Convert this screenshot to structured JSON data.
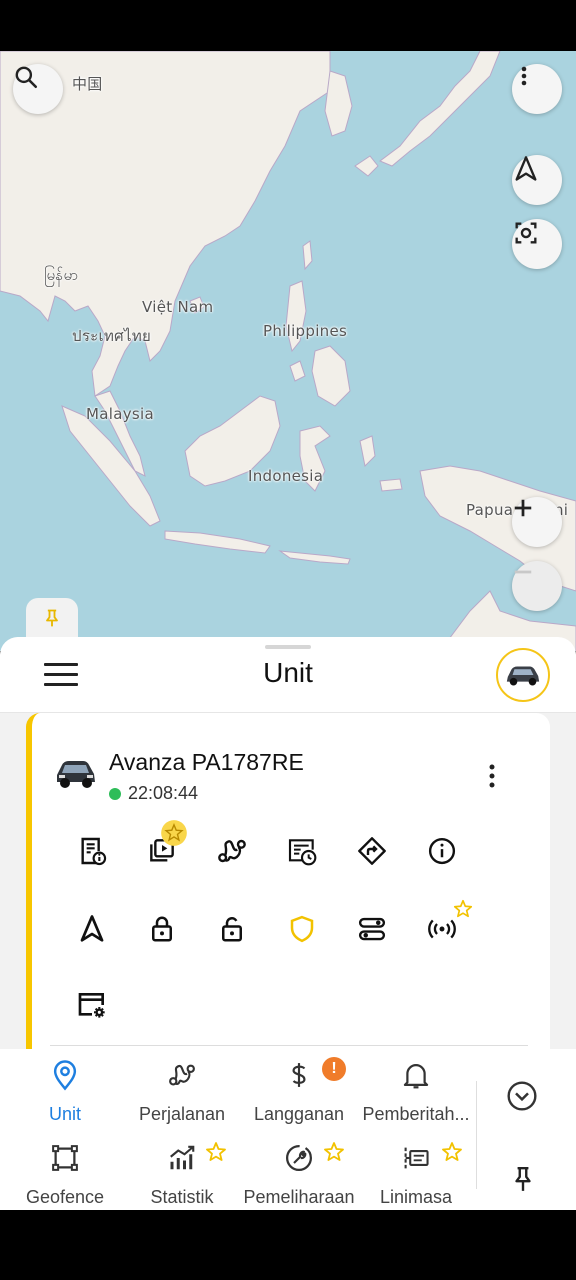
{
  "map": {
    "labels": {
      "china": "中国",
      "myanmar": "မြန်မာ",
      "vietnam": "Việt Nam",
      "thailand": "ประเทศไทย",
      "philippines": "Philippines",
      "malaysia": "Malaysia",
      "indonesia": "Indonesia",
      "papua": "Papua Nugini"
    }
  },
  "sheet": {
    "title": "Unit"
  },
  "unit": {
    "name": "Avanza PA1787RE",
    "time": "22:08:44",
    "status_color": "#2ebd59",
    "accent_color": "#f7c600"
  },
  "nav": {
    "items": [
      {
        "label": "Unit",
        "icon": "map-pin-icon"
      },
      {
        "label": "Perjalanan",
        "icon": "route-icon"
      },
      {
        "label": "Langganan",
        "icon": "dollar-icon",
        "badge": "!"
      },
      {
        "label": "Pemberitah...",
        "icon": "bell-icon"
      },
      {
        "label": "Geofence",
        "icon": "geofence-icon"
      },
      {
        "label": "Statistik",
        "icon": "statistics-icon"
      },
      {
        "label": "Pemeliharaan",
        "icon": "maintenance-icon"
      },
      {
        "label": "Linimasa",
        "icon": "timeline-icon"
      }
    ]
  },
  "colors": {
    "active": "#1e7fe0",
    "star": "#f2c200",
    "badge": "#f07c2a"
  }
}
